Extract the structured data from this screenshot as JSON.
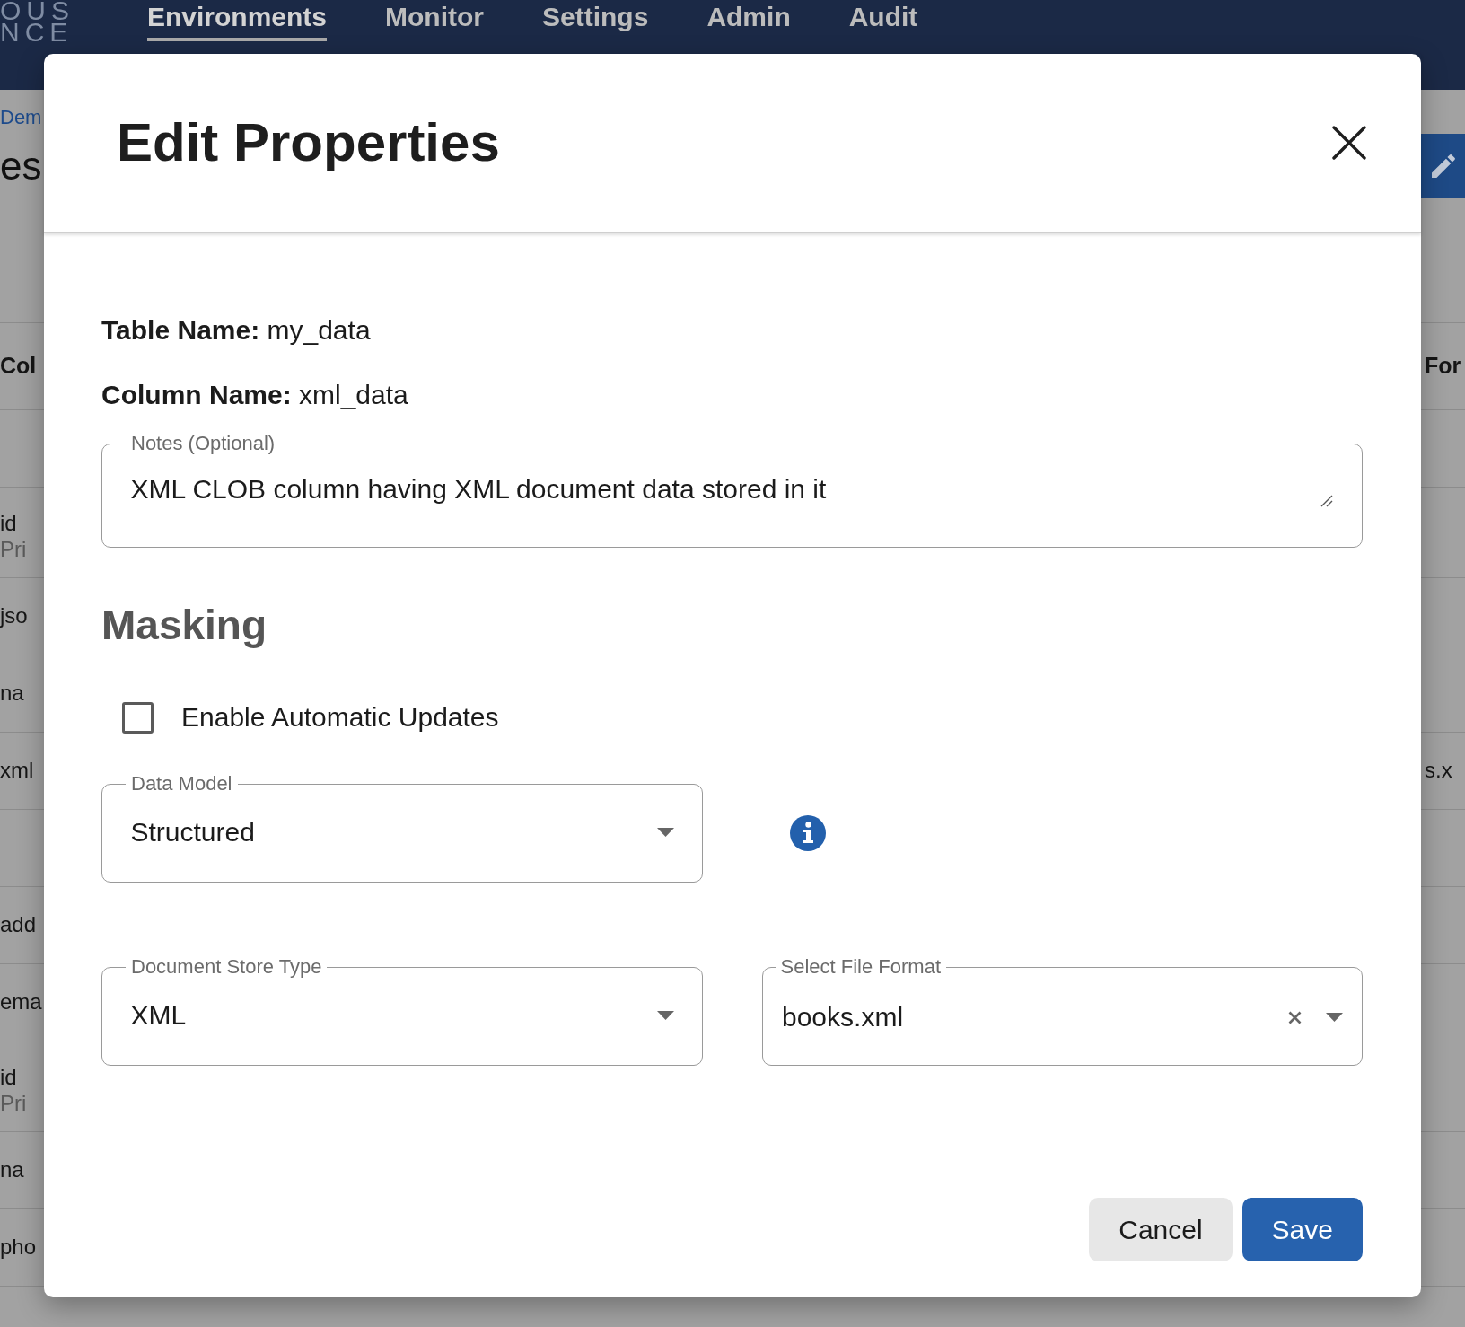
{
  "app_header": {
    "logo_lines": [
      "OUS",
      "NCE"
    ],
    "nav": [
      {
        "label": "Environments",
        "selected": true
      },
      {
        "label": "Monitor",
        "selected": false
      },
      {
        "label": "Settings",
        "selected": false
      },
      {
        "label": "Admin",
        "selected": false
      },
      {
        "label": "Audit",
        "selected": false
      }
    ]
  },
  "page": {
    "breadcrumb": "Dem",
    "title": "es",
    "table": {
      "header": {
        "left_cell": "Col",
        "right_cell": "For"
      },
      "groups": [
        {
          "rows": [
            {
              "left_cell": "id",
              "left_cell_subtext": "Pri"
            },
            {
              "left_cell": "jso"
            },
            {
              "left_cell": "na"
            },
            {
              "left_cell": "xml",
              "right_cell": "s.x"
            }
          ]
        },
        {
          "rows": [
            {
              "left_cell": "add"
            },
            {
              "left_cell": "ema"
            },
            {
              "left_cell": "id",
              "left_cell_subtext": "Pri"
            },
            {
              "left_cell": "na"
            },
            {
              "left_cell": "pho"
            }
          ]
        }
      ]
    }
  },
  "dialog": {
    "title": "Edit Properties",
    "details": [
      "**Table Name:** my_data",
      "**Column Name:** xml_data"
    ],
    "notes": {
      "kind": "textarea",
      "label": "Notes (Optional)",
      "value": "XML CLOB column having XML document data stored in it"
    },
    "section_title": "Masking",
    "auto_updates": {
      "label": "Enable Automatic Updates",
      "checked": false
    },
    "data_model": {
      "kind": "select",
      "label": "Data Model",
      "value": "Structured"
    },
    "store_fields": [
      {
        "kind": "select",
        "label": "Document Store Type",
        "value": "XML"
      },
      {
        "kind": "autocomplete",
        "label": "Select File Format",
        "value": "books.xml"
      }
    ],
    "buttons": [
      {
        "label": "Cancel",
        "kind": "secondary"
      },
      {
        "label": "Save",
        "kind": "primary"
      }
    ]
  }
}
